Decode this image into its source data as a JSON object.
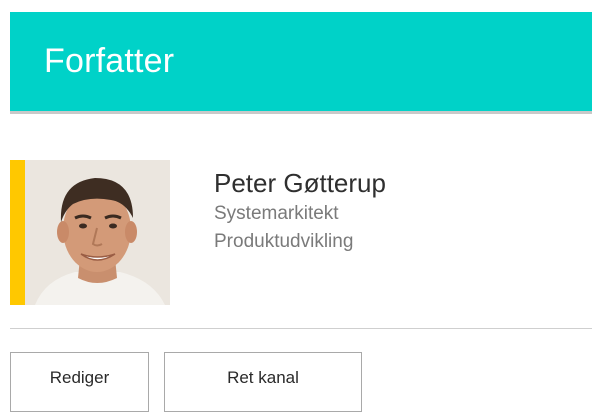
{
  "header": {
    "title": "Forfatter"
  },
  "author": {
    "name": "Peter Gøtterup",
    "job_title": "Systemarkitekt",
    "department": "Produktudvikling",
    "photo_icon": "person-photo",
    "accent_color": "#ffc800"
  },
  "actions": {
    "edit_label": "Rediger",
    "change_channel_label": "Ret kanal"
  },
  "colors": {
    "header_bg": "#00d2c8",
    "header_text": "#ffffff",
    "accent": "#ffc800"
  }
}
